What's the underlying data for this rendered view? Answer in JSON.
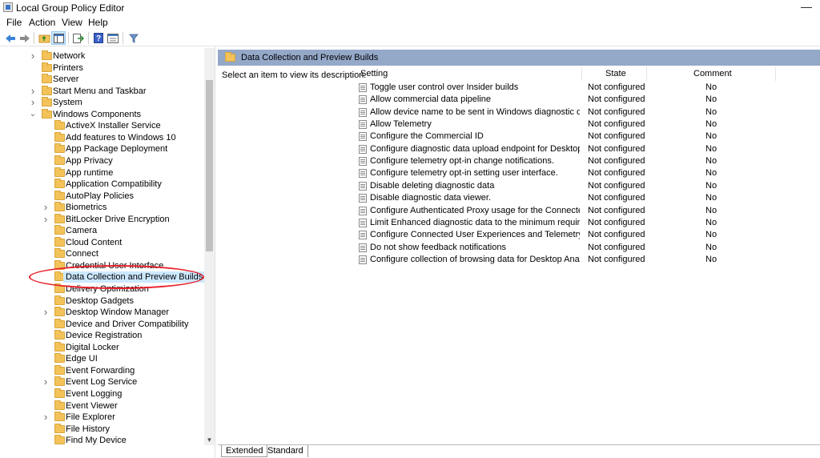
{
  "window": {
    "title": "Local Group Policy Editor",
    "minimize_glyph": "—"
  },
  "menu": [
    "File",
    "Action",
    "View",
    "Help"
  ],
  "toolbar": {
    "buttons": [
      "back-icon",
      "forward-icon",
      "up-folder-icon",
      "show-hide-tree-icon",
      "export-list-icon",
      "help-icon",
      "properties-icon",
      "filter-icon"
    ]
  },
  "tree": [
    {
      "label": "Network",
      "expander": ">",
      "indent": 1
    },
    {
      "label": "Printers",
      "expander": "",
      "indent": 1
    },
    {
      "label": "Server",
      "expander": "",
      "indent": 1
    },
    {
      "label": "Start Menu and Taskbar",
      "expander": ">",
      "indent": 1
    },
    {
      "label": "System",
      "expander": ">",
      "indent": 1
    },
    {
      "label": "Windows Components",
      "expander": "v",
      "indent": 1
    },
    {
      "label": "ActiveX Installer Service",
      "expander": "",
      "indent": 2
    },
    {
      "label": "Add features to Windows 10",
      "expander": "",
      "indent": 2
    },
    {
      "label": "App Package Deployment",
      "expander": "",
      "indent": 2
    },
    {
      "label": "App Privacy",
      "expander": "",
      "indent": 2
    },
    {
      "label": "App runtime",
      "expander": "",
      "indent": 2
    },
    {
      "label": "Application Compatibility",
      "expander": "",
      "indent": 2
    },
    {
      "label": "AutoPlay Policies",
      "expander": "",
      "indent": 2
    },
    {
      "label": "Biometrics",
      "expander": ">",
      "indent": 2
    },
    {
      "label": "BitLocker Drive Encryption",
      "expander": ">",
      "indent": 2
    },
    {
      "label": "Camera",
      "expander": "",
      "indent": 2
    },
    {
      "label": "Cloud Content",
      "expander": "",
      "indent": 2
    },
    {
      "label": "Connect",
      "expander": "",
      "indent": 2
    },
    {
      "label": "Credential User Interface",
      "expander": "",
      "indent": 2
    },
    {
      "label": "Data Collection and Preview Builds",
      "expander": "",
      "indent": 2,
      "selected": true
    },
    {
      "label": "Delivery Optimization",
      "expander": "",
      "indent": 2
    },
    {
      "label": "Desktop Gadgets",
      "expander": "",
      "indent": 2
    },
    {
      "label": "Desktop Window Manager",
      "expander": ">",
      "indent": 2
    },
    {
      "label": "Device and Driver Compatibility",
      "expander": "",
      "indent": 2
    },
    {
      "label": "Device Registration",
      "expander": "",
      "indent": 2
    },
    {
      "label": "Digital Locker",
      "expander": "",
      "indent": 2
    },
    {
      "label": "Edge UI",
      "expander": "",
      "indent": 2
    },
    {
      "label": "Event Forwarding",
      "expander": "",
      "indent": 2
    },
    {
      "label": "Event Log Service",
      "expander": ">",
      "indent": 2
    },
    {
      "label": "Event Logging",
      "expander": "",
      "indent": 2
    },
    {
      "label": "Event Viewer",
      "expander": "",
      "indent": 2
    },
    {
      "label": "File Explorer",
      "expander": ">",
      "indent": 2
    },
    {
      "label": "File History",
      "expander": "",
      "indent": 2
    },
    {
      "label": "Find My Device",
      "expander": "",
      "indent": 2
    }
  ],
  "right": {
    "header_title": "Data Collection and Preview Builds",
    "description": "Select an item to view its description.",
    "columns": {
      "setting": "Setting",
      "state": "State",
      "comment": "Comment"
    },
    "rows": [
      {
        "setting": "Toggle user control over Insider builds",
        "state": "Not configured",
        "comment": "No"
      },
      {
        "setting": "Allow commercial data pipeline",
        "state": "Not configured",
        "comment": "No"
      },
      {
        "setting": "Allow device name to be sent in Windows diagnostic data",
        "state": "Not configured",
        "comment": "No"
      },
      {
        "setting": "Allow Telemetry",
        "state": "Not configured",
        "comment": "No"
      },
      {
        "setting": "Configure the Commercial ID",
        "state": "Not configured",
        "comment": "No"
      },
      {
        "setting": "Configure diagnostic data upload endpoint for Desktop Ana...",
        "state": "Not configured",
        "comment": "No"
      },
      {
        "setting": "Configure telemetry opt-in change notifications.",
        "state": "Not configured",
        "comment": "No"
      },
      {
        "setting": "Configure telemetry opt-in setting user interface.",
        "state": "Not configured",
        "comment": "No"
      },
      {
        "setting": "Disable deleting diagnostic data",
        "state": "Not configured",
        "comment": "No"
      },
      {
        "setting": "Disable diagnostic data viewer.",
        "state": "Not configured",
        "comment": "No"
      },
      {
        "setting": "Configure Authenticated Proxy usage for the Connected Us...",
        "state": "Not configured",
        "comment": "No"
      },
      {
        "setting": "Limit Enhanced diagnostic data to the minimum required b...",
        "state": "Not configured",
        "comment": "No"
      },
      {
        "setting": "Configure Connected User Experiences and Telemetry",
        "state": "Not configured",
        "comment": "No"
      },
      {
        "setting": "Do not show feedback notifications",
        "state": "Not configured",
        "comment": "No"
      },
      {
        "setting": "Configure collection of browsing data for Desktop Analytics",
        "state": "Not configured",
        "comment": "No"
      }
    ]
  },
  "tabs": [
    "Extended",
    "Standard"
  ],
  "colors": {
    "header_bar": "#94a8c8",
    "selection": "#cce8ff",
    "annotation": "#e8202a"
  }
}
